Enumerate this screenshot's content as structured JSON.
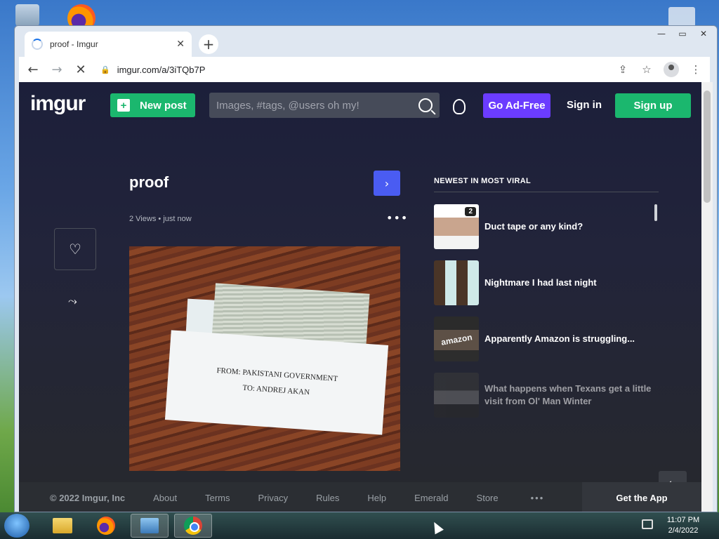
{
  "tab": {
    "title": "proof - Imgur",
    "close": "✕",
    "new_tab": "+"
  },
  "toolbar": {
    "back": "←",
    "forward": "→",
    "reload": "✕",
    "url": "imgur.com/a/3iTQb7P",
    "lock": "🔒",
    "share": "⇪",
    "star": "☆",
    "menu": "⋮"
  },
  "window": {
    "minimize": "—",
    "maximize": "▭",
    "close": "✕"
  },
  "header": {
    "logo": "imgur",
    "new_post": "New post",
    "search_placeholder": "Images, #tags, @users oh my!",
    "ad_free": "Go Ad-Free",
    "sign_in": "Sign in",
    "sign_up": "Sign up"
  },
  "post": {
    "title": "proof",
    "views": "2 Views",
    "separator": "•",
    "time": "just now",
    "more": "•••",
    "next": "›",
    "like": "♡",
    "share": "⤳",
    "envelope_line1": "FROM: PAKISTANI GOVERNMENT",
    "envelope_line2": "TO: ANDREJ AKAN"
  },
  "viral": {
    "title": "NEWEST IN MOST VIRAL",
    "items": [
      {
        "label": "Duct tape or any kind?",
        "count": "2"
      },
      {
        "label": "Nightmare I had last night"
      },
      {
        "label": "Apparently Amazon is struggling...",
        "thumb_text": "amazon"
      },
      {
        "label": "What happens when Texans get a little visit from Ol' Man Winter"
      }
    ]
  },
  "exit": "⇦",
  "footer": {
    "copyright": "© 2022 Imgur, Inc",
    "links": [
      "About",
      "Terms",
      "Privacy",
      "Rules",
      "Help",
      "Emerald",
      "Store"
    ],
    "more": "•••",
    "get_app": "Get the App"
  },
  "taskbar": {
    "time": "11:07 PM",
    "date": "2/4/2022"
  },
  "colors": {
    "imgur_green": "#1bb76e",
    "ad_free_purple": "#6b3cff",
    "next_blue": "#4a5cf2",
    "page_bg": "#27292d"
  }
}
